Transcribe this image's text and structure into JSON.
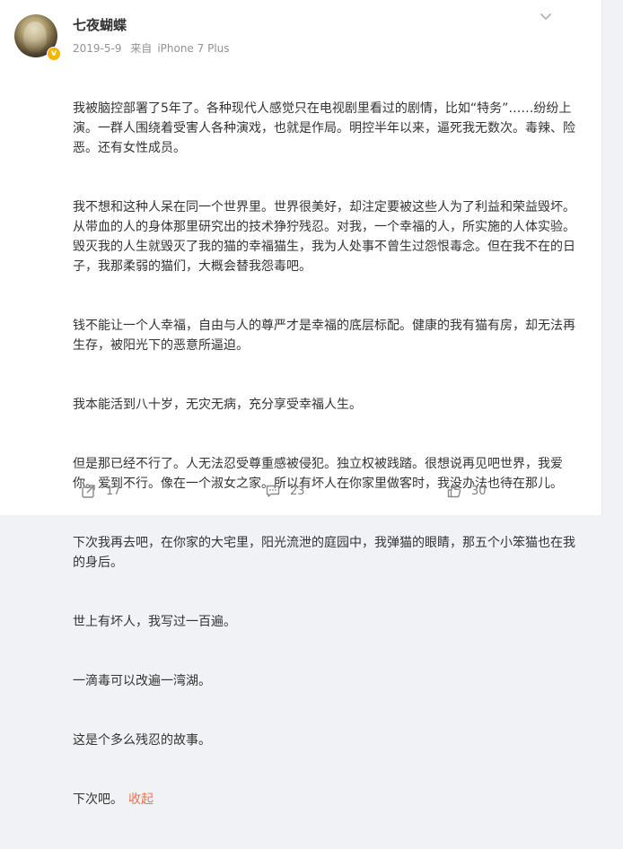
{
  "user": {
    "name": "七夜蝴蝶",
    "verified_badge": "v",
    "date": "2019-5-9",
    "source_prefix": "来自",
    "device": "iPhone 7 Plus"
  },
  "post": {
    "paragraphs": [
      "我被脑控部署了5年了。各种现代人感觉只在电视剧里看过的剧情，比如“特务”……纷纷上演。一群人围绕着受害人各种演戏，也就是作局。明控半年以来，逼死我无数次。毒辣、险恶。还有女性成员。",
      "我不想和这种人呆在同一个世界里。世界很美好，却注定要被这些人为了利益和荣益毁坏。从带血的人的身体那里研究出的技术狰狞残忍。对我，一个幸福的人，所实施的人体实验。毁灭我的人生就毁灭了我的猫的幸福猫生，我为人处事不曾生过怨恨毒念。但在我不在的日子，我那柔弱的猫们，大概会替我怨毒吧。",
      "钱不能让一个人幸福，自由与人的尊严才是幸福的底层标配。健康的我有猫有房，却无法再生存，被阳光下的恶意所逼迫。",
      "我本能活到八十岁，无灾无病，充分享受幸福人生。",
      "但是那已经不行了。人无法忍受尊重感被侵犯。独立权被践踏。很想说再见吧世界，我爱你。爱到不行。像在一个淑女之家。所以有坏人在你家里做客时，我没办法也待在那儿。",
      "下次我再去吧，在你家的大宅里，阳光流泄的庭园中，我弹猫的眼睛，那五个小笨猫也在我的身后。",
      "世上有坏人，我写过一百遍。",
      "一滴毒可以改遍一湾湖。",
      "这是个多么残忍的故事。",
      "下次吧。"
    ],
    "collapse_label": "收起"
  },
  "footer": {
    "repost_count": "17",
    "comment_count": "23",
    "like_count": "30"
  },
  "colors": {
    "accent": "#eb7350",
    "text": "#333333",
    "muted": "#939393"
  },
  "icons": [
    "chevron-down-icon",
    "repost-icon",
    "comment-icon",
    "like-icon"
  ]
}
